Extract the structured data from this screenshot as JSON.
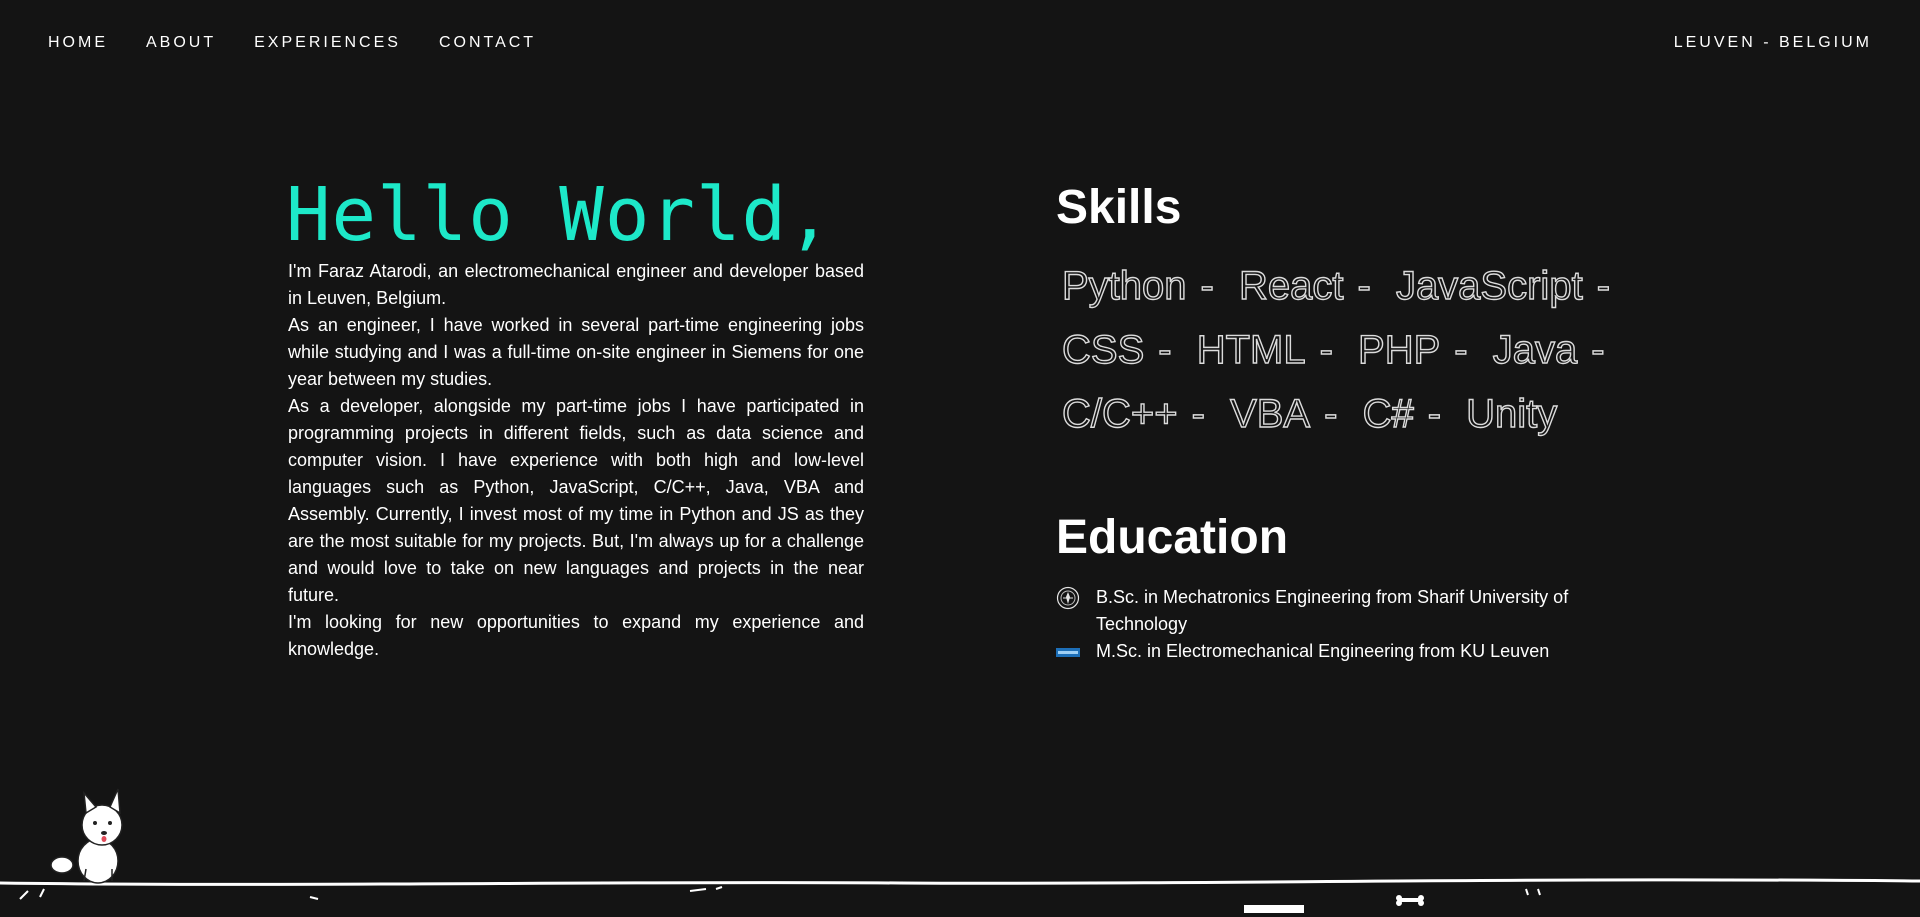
{
  "nav": {
    "items": [
      "HOME",
      "ABOUT",
      "EXPERIENCES",
      "CONTACT"
    ],
    "location": "LEUVEN - BELGIUM"
  },
  "intro": {
    "greeting": "Hello World,",
    "paragraphs": [
      "I'm Faraz Atarodi, an electromechanical engineer and developer based in Leuven, Belgium.",
      "As an engineer, I have worked in several part-time engineering jobs while studying and I was a full-time on-site engineer in Siemens for one year between my studies.",
      "As a developer, alongside my part-time jobs I have participated in programming projects in different fields, such as data science and computer vision. I have experience with both high and low-level languages such as Python, JavaScript, C/C++, Java, VBA and Assembly. Currently, I invest most of my time in Python and JS as they are the most suitable for my projects. But, I'm always up for a challenge and would love to take on new languages and projects in the near future.",
      "I'm looking for new opportunities to expand my experience and knowledge."
    ]
  },
  "skills": {
    "title": "Skills",
    "items": [
      "Python",
      "React",
      "JavaScript",
      "CSS",
      "HTML",
      "PHP",
      "Java",
      "C/C++",
      "VBA",
      "C#",
      "Unity"
    ],
    "separator": "-"
  },
  "education": {
    "title": "Education",
    "items": [
      {
        "icon": "sharif-university-logo-icon",
        "text": "B.Sc. in Mechatronics Engineering from Sharif University of Technology"
      },
      {
        "icon": "ku-leuven-logo-icon",
        "text": "M.Sc. in Electromechanical Engineering from KU Leuven"
      }
    ]
  },
  "footer": {
    "mascot": "dog-icon"
  },
  "colors": {
    "background": "#141414",
    "accent": "#1de9c9",
    "text": "#ffffff"
  }
}
